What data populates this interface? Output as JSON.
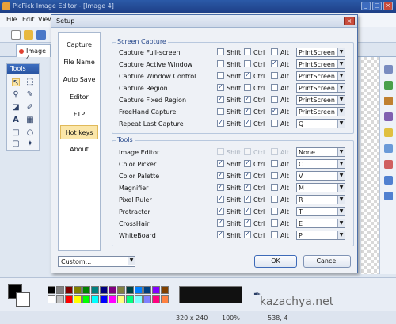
{
  "app": {
    "title": "PicPick Image Editor - [Image 4]",
    "menu": [
      "File",
      "Edit",
      "View"
    ],
    "doc_tab": "Image 4",
    "tools_title": "Tools",
    "status": {
      "size": "320 x 240",
      "zoom": "100%",
      "coords": "538, 4"
    }
  },
  "dialog": {
    "title": "Setup",
    "nav": [
      {
        "label": "Capture",
        "active": false
      },
      {
        "label": "File Name",
        "active": false
      },
      {
        "label": "Auto Save",
        "active": false
      },
      {
        "label": "Editor",
        "active": false
      },
      {
        "label": "FTP",
        "active": false
      },
      {
        "label": "Hot keys",
        "active": true
      },
      {
        "label": "About",
        "active": false
      }
    ],
    "modifiers": {
      "shift": "Shift",
      "ctrl": "Ctrl",
      "alt": "Alt"
    },
    "screen_capture": {
      "title": "Screen Capture",
      "rows": [
        {
          "label": "Capture Full-screen",
          "shift": false,
          "ctrl": false,
          "alt": false,
          "key": "PrintScreen"
        },
        {
          "label": "Capture Active Window",
          "shift": false,
          "ctrl": false,
          "alt": true,
          "key": "PrintScreen"
        },
        {
          "label": "Capture Window Control",
          "shift": false,
          "ctrl": true,
          "alt": false,
          "key": "PrintScreen"
        },
        {
          "label": "Capture Region",
          "shift": true,
          "ctrl": false,
          "alt": false,
          "key": "PrintScreen"
        },
        {
          "label": "Capture Fixed Region",
          "shift": true,
          "ctrl": true,
          "alt": false,
          "key": "PrintScreen"
        },
        {
          "label": "FreeHand Capture",
          "shift": false,
          "ctrl": true,
          "alt": true,
          "key": "PrintScreen"
        },
        {
          "label": "Repeat Last Capture",
          "shift": true,
          "ctrl": true,
          "alt": false,
          "key": "Q"
        }
      ]
    },
    "tools": {
      "title": "Tools",
      "rows": [
        {
          "label": "Image Editor",
          "shift": false,
          "ctrl": false,
          "alt": false,
          "key": "None",
          "disabled": true
        },
        {
          "label": "Color Picker",
          "shift": true,
          "ctrl": true,
          "alt": false,
          "key": "C"
        },
        {
          "label": "Color Palette",
          "shift": true,
          "ctrl": true,
          "alt": false,
          "key": "V"
        },
        {
          "label": "Magnifier",
          "shift": true,
          "ctrl": true,
          "alt": false,
          "key": "M"
        },
        {
          "label": "Pixel Ruler",
          "shift": true,
          "ctrl": true,
          "alt": false,
          "key": "R"
        },
        {
          "label": "Protractor",
          "shift": true,
          "ctrl": true,
          "alt": false,
          "key": "T"
        },
        {
          "label": "CrossHair",
          "shift": true,
          "ctrl": true,
          "alt": false,
          "key": "E"
        },
        {
          "label": "WhiteBoard",
          "shift": true,
          "ctrl": true,
          "alt": false,
          "key": "P"
        }
      ]
    },
    "preset": "Custom...",
    "ok_label": "OK",
    "cancel_label": "Cancel"
  },
  "watermark": "kazachya.net",
  "colors": {
    "swatches": [
      "#000000",
      "#808080",
      "#800000",
      "#808000",
      "#008000",
      "#008080",
      "#000080",
      "#800080",
      "#808040",
      "#004040",
      "#0080ff",
      "#004080",
      "#8000ff",
      "#804000",
      "#ffffff",
      "#c0c0c0",
      "#ff0000",
      "#ffff00",
      "#00ff00",
      "#00ffff",
      "#0000ff",
      "#ff00ff",
      "#ffff80",
      "#00ff80",
      "#80ffff",
      "#8080ff",
      "#ff0080",
      "#ff8040"
    ]
  }
}
